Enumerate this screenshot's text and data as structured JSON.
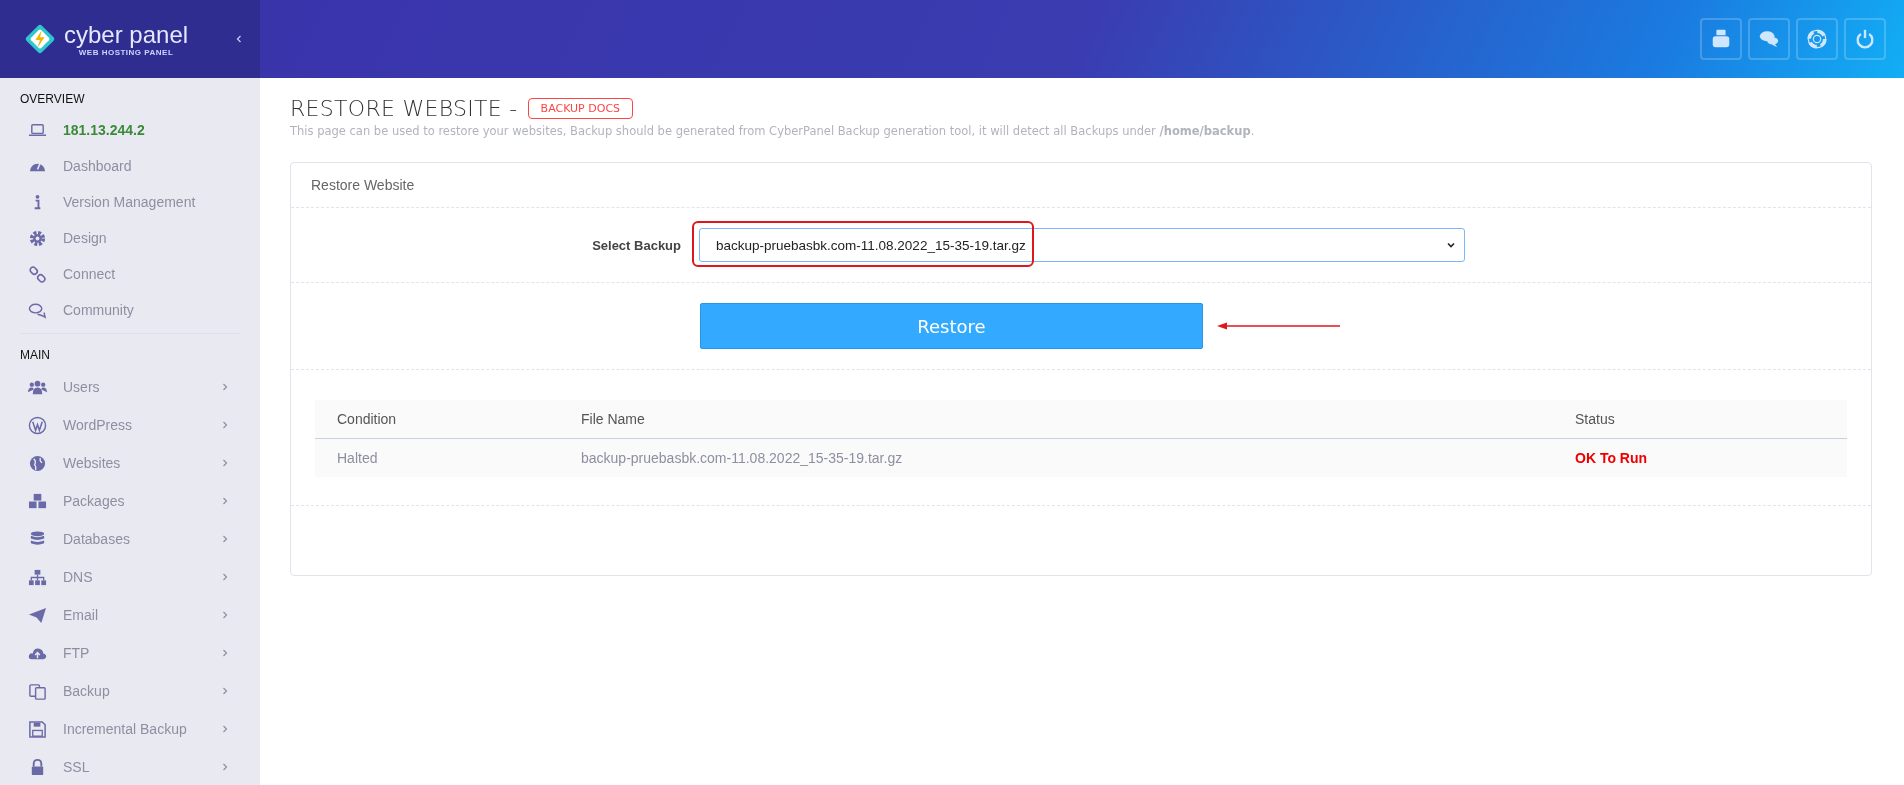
{
  "brand": {
    "name": "cyber panel",
    "tagline": "WEB HOSTING PANEL"
  },
  "sidebar": {
    "sections": [
      {
        "title": "OVERVIEW",
        "items": [
          {
            "label": "181.13.244.2",
            "selected": true,
            "has_submenu": false
          },
          {
            "label": "Dashboard",
            "selected": false,
            "has_submenu": false
          },
          {
            "label": "Version Management",
            "selected": false,
            "has_submenu": false
          },
          {
            "label": "Design",
            "selected": false,
            "has_submenu": false
          },
          {
            "label": "Connect",
            "selected": false,
            "has_submenu": false
          },
          {
            "label": "Community",
            "selected": false,
            "has_submenu": false
          }
        ]
      },
      {
        "title": "MAIN",
        "items": [
          {
            "label": "Users",
            "selected": false,
            "has_submenu": true
          },
          {
            "label": "WordPress",
            "selected": false,
            "has_submenu": true
          },
          {
            "label": "Websites",
            "selected": false,
            "has_submenu": true
          },
          {
            "label": "Packages",
            "selected": false,
            "has_submenu": true
          },
          {
            "label": "Databases",
            "selected": false,
            "has_submenu": true
          },
          {
            "label": "DNS",
            "selected": false,
            "has_submenu": true
          },
          {
            "label": "Email",
            "selected": false,
            "has_submenu": true
          },
          {
            "label": "FTP",
            "selected": false,
            "has_submenu": true
          },
          {
            "label": "Backup",
            "selected": false,
            "has_submenu": true
          },
          {
            "label": "Incremental Backup",
            "selected": false,
            "has_submenu": true
          },
          {
            "label": "SSL",
            "selected": false,
            "has_submenu": true
          }
        ]
      }
    ]
  },
  "page": {
    "title": "RESTORE WEBSITE -",
    "docs_badge": "BACKUP DOCS",
    "description": "This page can be used to restore your websites, Backup should be generated from CyberPanel Backup generation tool, it will detect all Backups under **/home/backup**."
  },
  "card": {
    "title": "Restore Website",
    "select": {
      "label": "Select Backup",
      "value": "backup-pruebasbk.com-11.08.2022_15-35-19.tar.gz"
    },
    "button": "Restore"
  },
  "table": {
    "columns": [
      "Condition",
      "File Name",
      "Status"
    ],
    "rows": [
      {
        "condition": "Halted",
        "file_name": "backup-pruebasbk.com-11.08.2022_15-35-19.tar.gz",
        "status": "OK To Run"
      }
    ]
  }
}
